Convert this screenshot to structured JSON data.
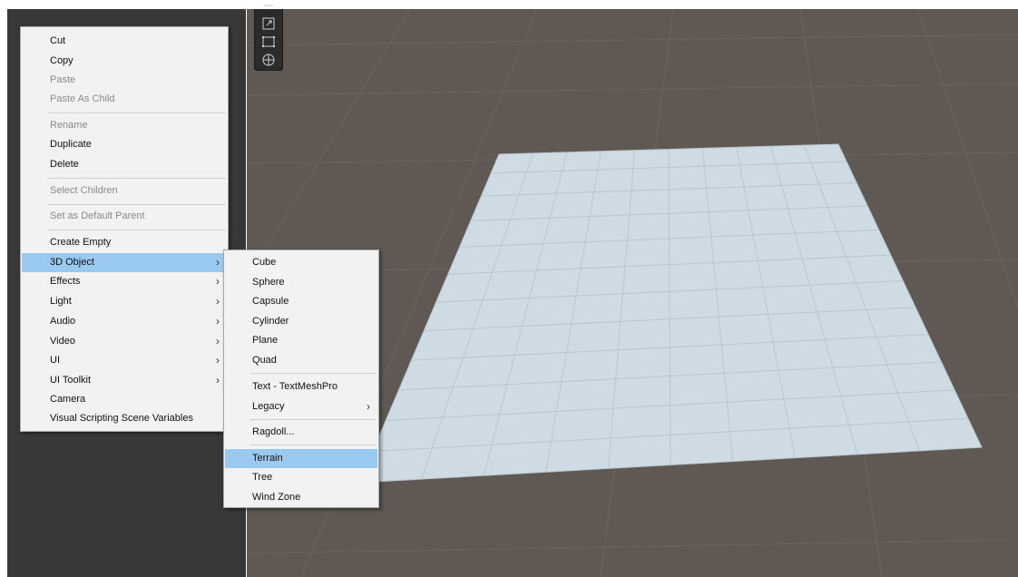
{
  "main_menu": {
    "items": [
      {
        "label": "Cut"
      },
      {
        "label": "Copy"
      },
      {
        "label": "Paste"
      },
      {
        "label": "Paste As Child"
      },
      {
        "label": "Rename"
      },
      {
        "label": "Duplicate"
      },
      {
        "label": "Delete"
      },
      {
        "label": "Select Children"
      },
      {
        "label": "Set as Default Parent"
      },
      {
        "label": "Create Empty"
      },
      {
        "label": "3D Object"
      },
      {
        "label": "Effects"
      },
      {
        "label": "Light"
      },
      {
        "label": "Audio"
      },
      {
        "label": "Video"
      },
      {
        "label": "UI"
      },
      {
        "label": "UI Toolkit"
      },
      {
        "label": "Camera"
      },
      {
        "label": "Visual Scripting Scene Variables"
      }
    ],
    "submenu_arrow": "›"
  },
  "submenu_3d_object": {
    "items": [
      {
        "label": "Cube"
      },
      {
        "label": "Sphere"
      },
      {
        "label": "Capsule"
      },
      {
        "label": "Cylinder"
      },
      {
        "label": "Plane"
      },
      {
        "label": "Quad"
      },
      {
        "label": "Text - TextMeshPro"
      },
      {
        "label": "Legacy"
      },
      {
        "label": "Ragdoll..."
      },
      {
        "label": "Terrain"
      },
      {
        "label": "Tree"
      },
      {
        "label": "Wind Zone"
      }
    ]
  },
  "colors": {
    "highlight": "#99c9ef",
    "menu_background": "#f2f2f2",
    "disabled_text": "#8a8a8a",
    "scene_background": "#5f5853",
    "plane_surface": "#cfdbe3",
    "hierarchy_background": "#383838"
  },
  "icons": {
    "tool_strip": [
      "rect-transform-icon",
      "scale-icon",
      "rect-tool-icon",
      "transform-icon"
    ]
  }
}
